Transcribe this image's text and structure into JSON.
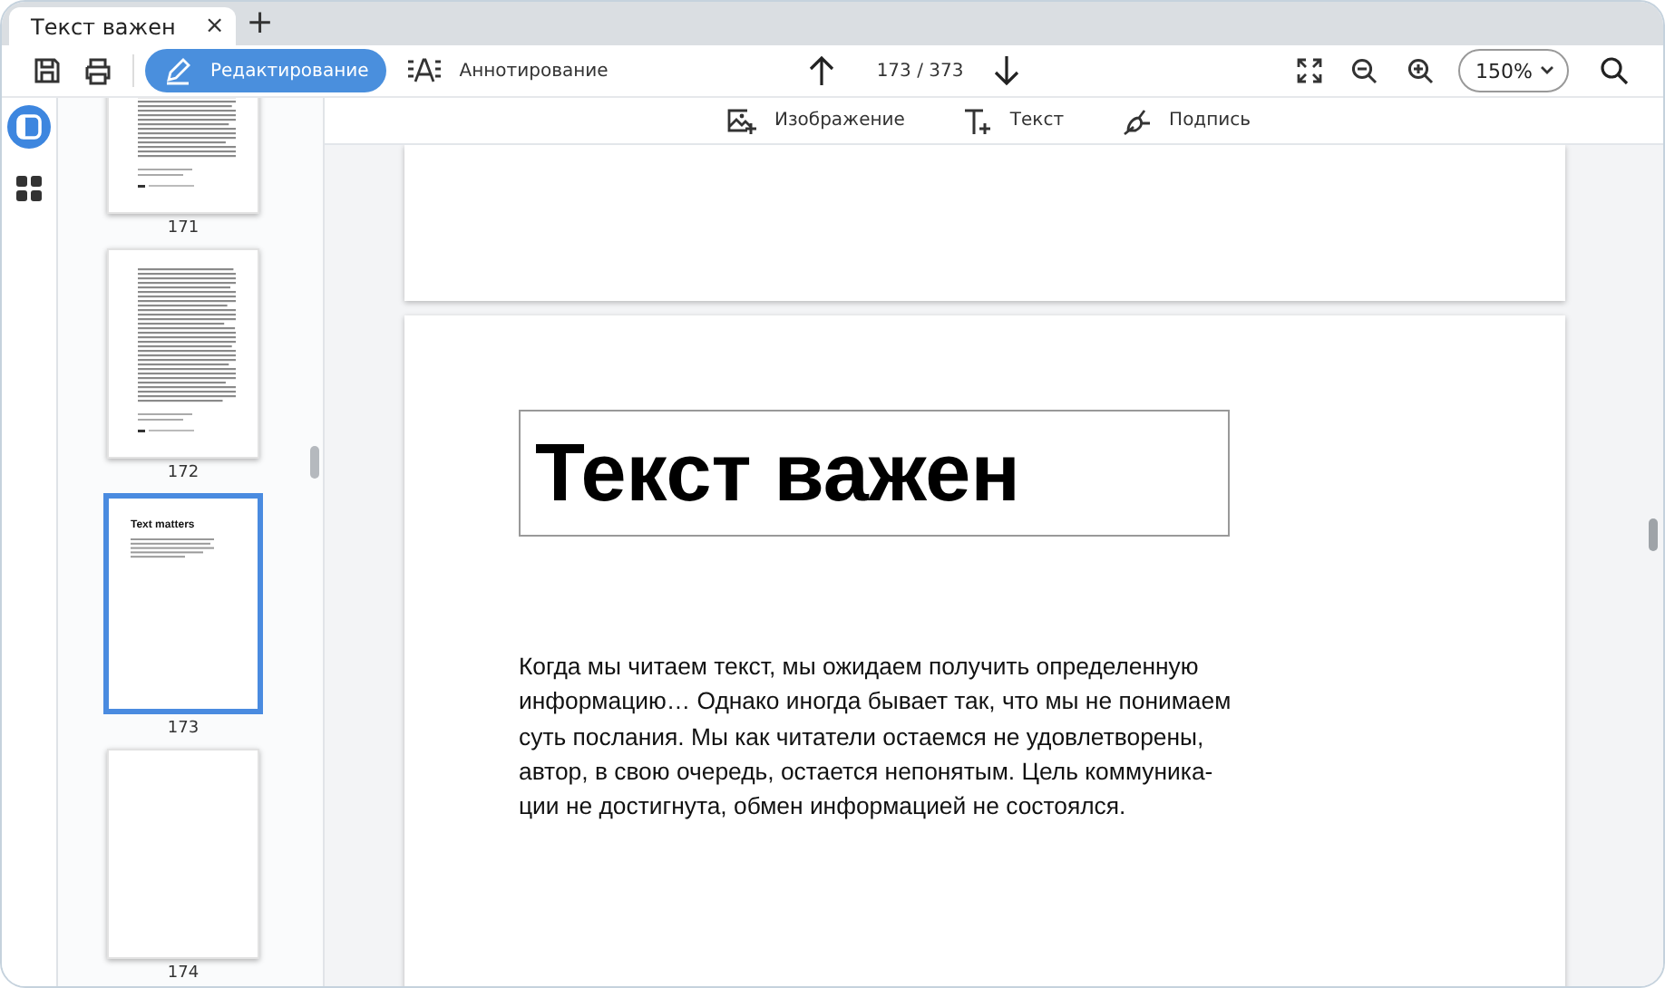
{
  "tabs": [
    {
      "label": "Текст важен",
      "selected": true,
      "close": "×"
    }
  ],
  "new_tab": "+",
  "modes": [
    {
      "label": "Редактирование",
      "kind": "edit",
      "selected": true
    },
    {
      "label": "Аннотирование",
      "kind": "annotate",
      "selected": false
    }
  ],
  "page_indicator": "173 / 373",
  "zoom": "150%",
  "insert_tools": [
    {
      "label": "Изображение",
      "kind": "image"
    },
    {
      "label": "Текст",
      "kind": "text"
    },
    {
      "label": "Подпись",
      "kind": "signature"
    }
  ],
  "rail": [
    {
      "kind": "thumbnails",
      "selected": true
    },
    {
      "kind": "grid",
      "selected": false
    }
  ],
  "thumbnails": [
    {
      "label": "171",
      "kind": "text",
      "selected": false
    },
    {
      "label": "172",
      "kind": "text",
      "selected": false
    },
    {
      "label": "173",
      "kind": "title",
      "title": "Text matters",
      "selected": true
    },
    {
      "label": "174",
      "kind": "blank",
      "selected": false
    }
  ],
  "document": {
    "heading": "Текст важен",
    "lines": [
      "Когда мы читаем текст, мы ожидаем получить определенную",
      "информацию… Однако иногда бывает так, что мы не понимаем",
      "суть послания. Мы как читатели остаемся не удовлетворены,",
      "автор, в свою очередь, остается непонятым. Цель коммуника-",
      "ции не достигнута, обмен информацией не состоялся."
    ]
  }
}
